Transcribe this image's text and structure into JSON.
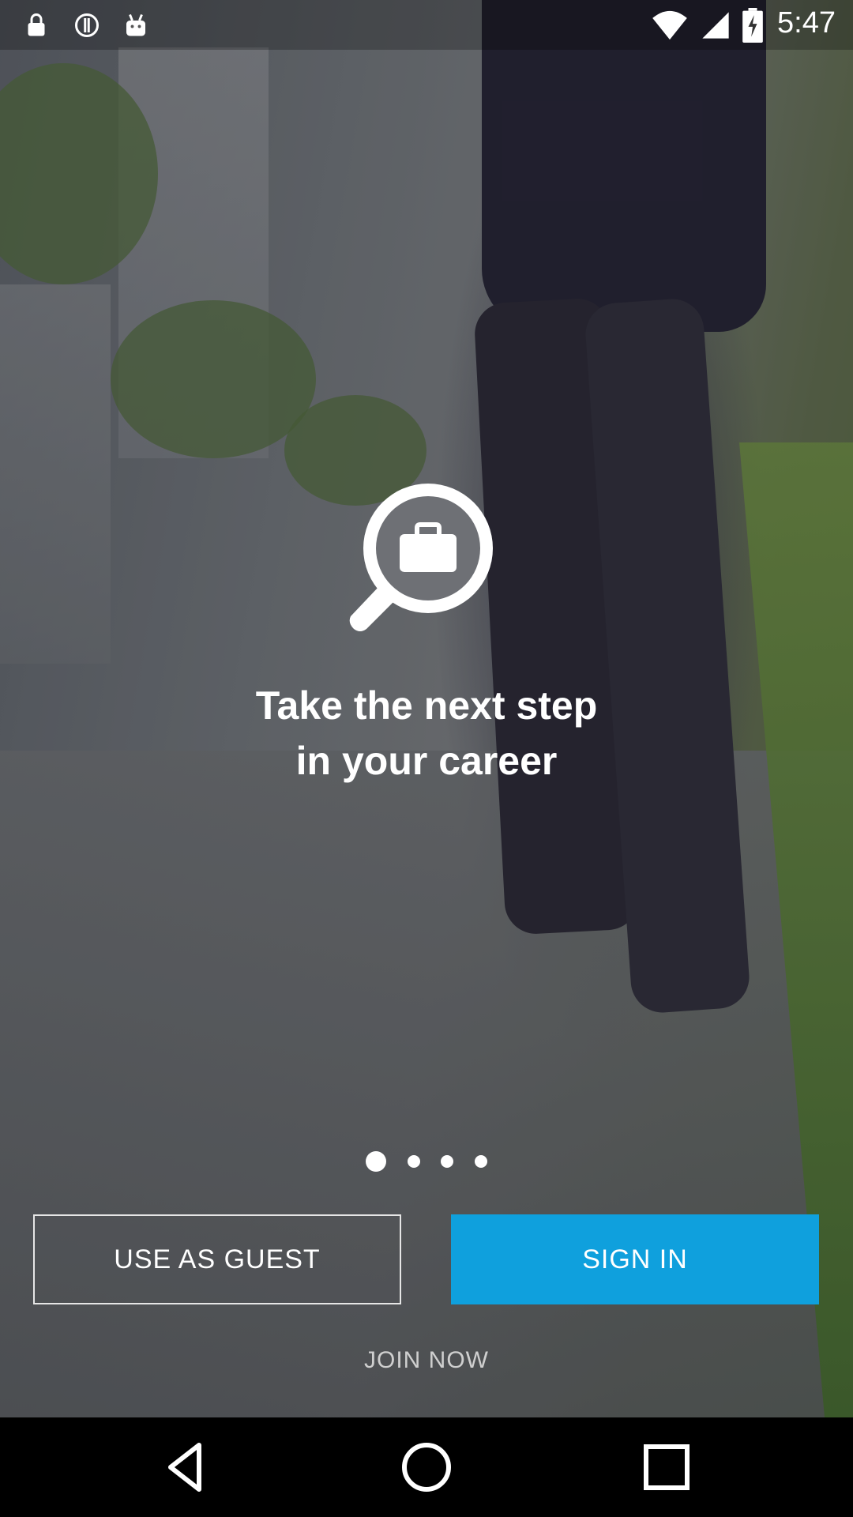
{
  "status_bar": {
    "time": "5:47",
    "icons": [
      "lock-icon",
      "info-icon",
      "android-icon",
      "wifi-icon",
      "signal-icon",
      "battery-icon"
    ]
  },
  "onboarding": {
    "logo_icon": "job-search-magnifier-icon",
    "headline_line1": "Take the next step",
    "headline_line2": "in your career",
    "pager": {
      "total": 4,
      "active": 1
    }
  },
  "actions": {
    "guest_label": "USE AS GUEST",
    "signin_label": "SIGN IN",
    "join_label": "JOIN NOW"
  },
  "colors": {
    "accent": "#0fa0dd",
    "text": "#ffffff",
    "join_text": "#cfcfcf"
  },
  "nav_bar": {
    "buttons": [
      "back-icon",
      "home-icon",
      "recents-icon"
    ]
  }
}
